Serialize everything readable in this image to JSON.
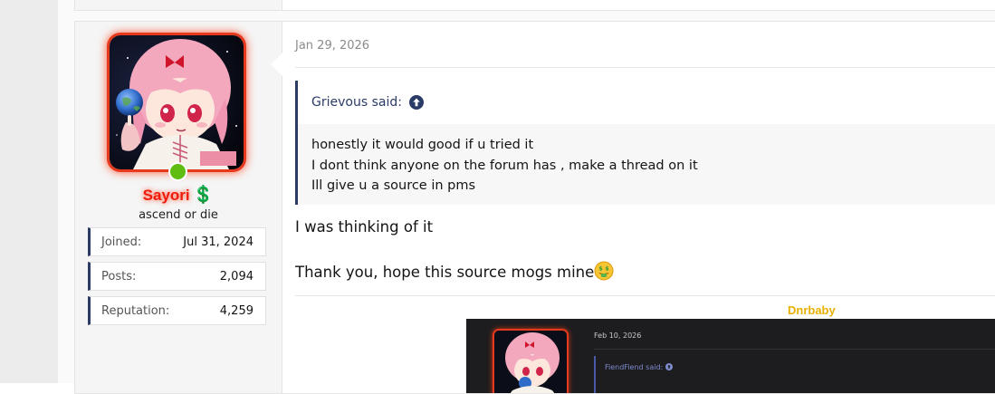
{
  "previous_post": {},
  "post": {
    "user": {
      "name": "Sayori",
      "badge_icon": "dollar-icon",
      "badge_glyph": "💲",
      "title": "ascend or die",
      "online": true,
      "name_color": "#f01a0a",
      "stats": [
        {
          "label": "Joined:",
          "value": "Jul 31, 2024"
        },
        {
          "label": "Posts:",
          "value": "2,094"
        },
        {
          "label": "Reputation:",
          "value": "4,259"
        }
      ]
    },
    "date": "Jan 29, 2026",
    "quote": {
      "author": "Grievous said:",
      "lines": [
        "honestly it would good if u tried it",
        "I dont think anyone on the forum has , make a thread on it",
        "Ill give u a source in pms"
      ]
    },
    "reply": {
      "line1": "I was thinking of it",
      "line2": "Thank you, hope this source mogs mine",
      "emoji": "money-mouth-face"
    },
    "signature": {
      "name": "Dnrbaby",
      "name_color": "#e8b000",
      "image": {
        "date": "Feb 10, 2026",
        "quote_author": "FiendFiend said:"
      }
    }
  },
  "colors": {
    "accent": "#2a3b66",
    "online": "#5ebd10",
    "avatar_glow": "#e63a1e"
  }
}
